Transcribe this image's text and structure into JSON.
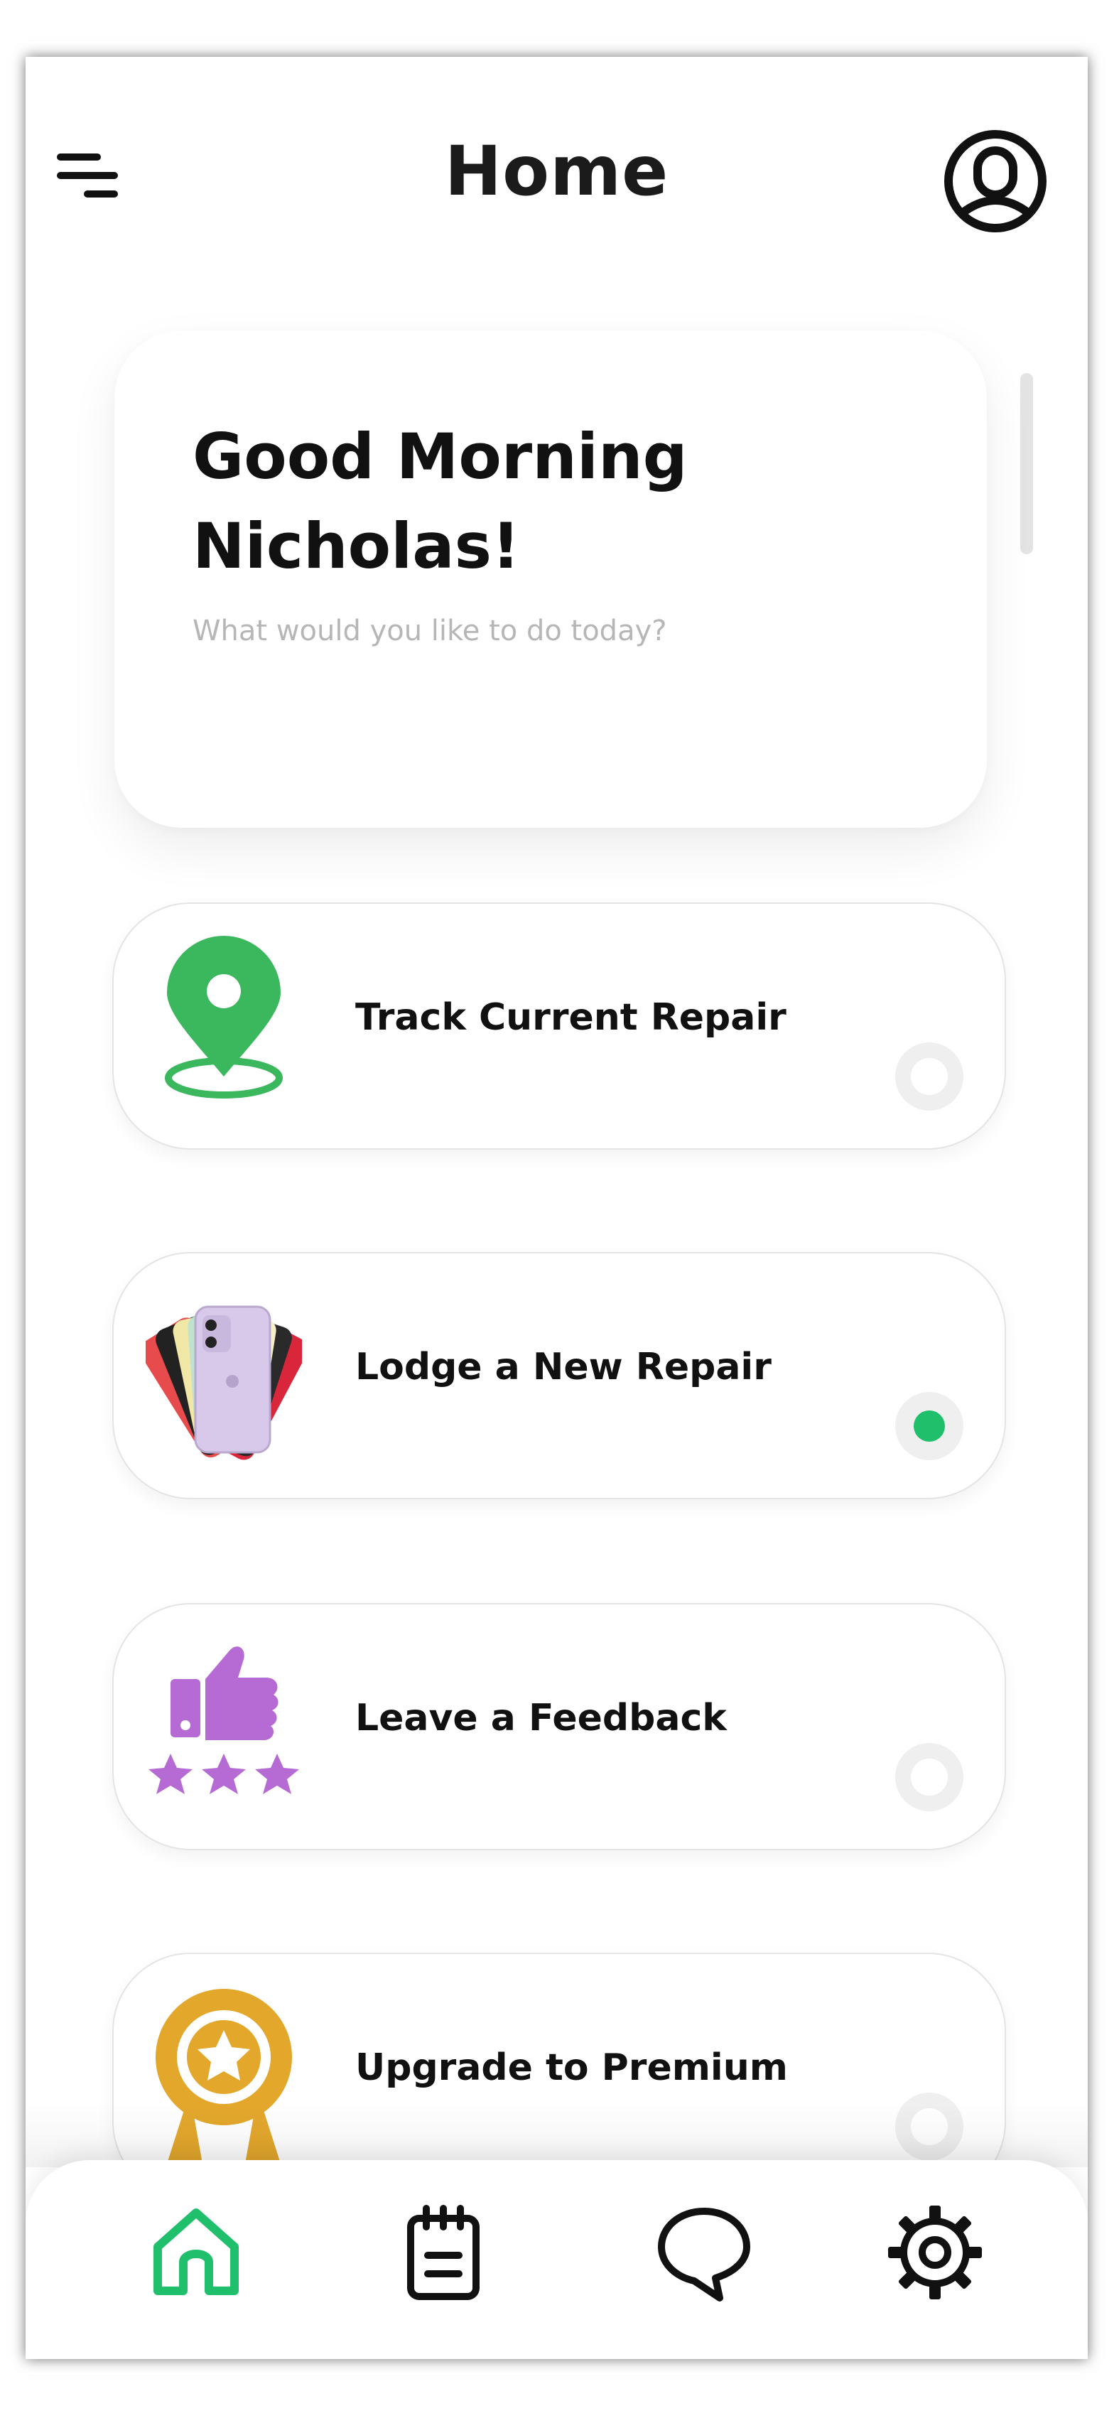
{
  "header": {
    "title": "Home"
  },
  "greeting": {
    "title": "Good Morning Nicholas!",
    "subtitle": "What would you like to do today?"
  },
  "actions": [
    {
      "label": "Track Current Repair",
      "icon": "location-pin-icon",
      "selected": false,
      "icon_color": "#3bb75e"
    },
    {
      "label": "Lodge a New Repair",
      "icon": "phones-icon",
      "selected": true,
      "icon_color": "#d8c9ea"
    },
    {
      "label": "Leave a Feedback",
      "icon": "thumbs-up-icon",
      "selected": false,
      "icon_color": "#b56ad4"
    },
    {
      "label": "Upgrade to Premium",
      "icon": "award-badge-icon",
      "selected": false,
      "icon_color": "#e3a72c"
    }
  ],
  "bottom_nav": {
    "items": [
      "home-icon",
      "notepad-icon",
      "chat-icon",
      "settings-icon"
    ],
    "active": "home-icon",
    "active_color": "#1fbf6b"
  }
}
